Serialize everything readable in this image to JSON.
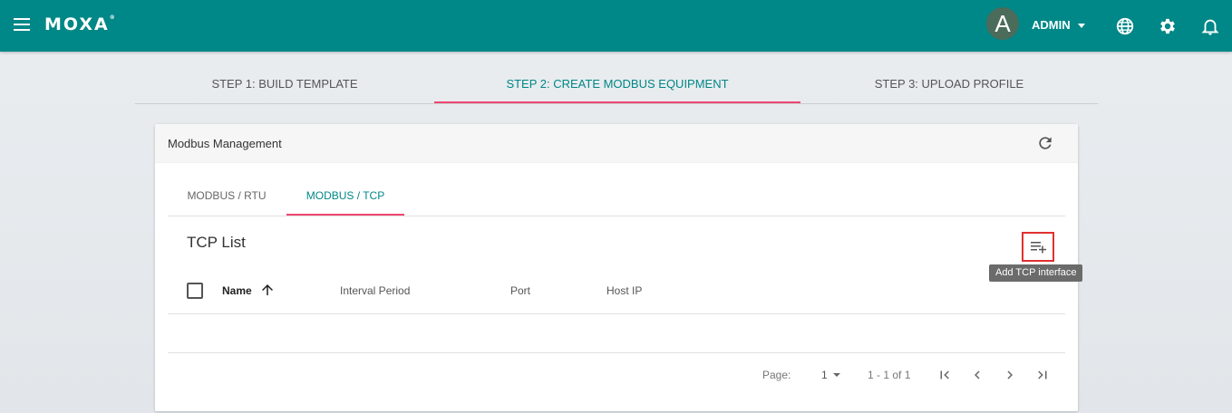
{
  "header": {
    "logo_text": "MOXA",
    "logo_mark": "®",
    "avatar_letter": "A",
    "user_name": "ADMIN",
    "menu_icon": "menu-icon",
    "globe_icon": "globe-icon",
    "settings_icon": "gear-icon",
    "notification_icon": "bell-icon",
    "brand_color": "#008787",
    "accent_color": "#ee4771"
  },
  "steps": [
    {
      "label": "STEP 1: BUILD TEMPLATE",
      "active": false
    },
    {
      "label": "STEP 2: CREATE MODBUS EQUIPMENT",
      "active": true
    },
    {
      "label": "STEP 3: UPLOAD PROFILE",
      "active": false
    }
  ],
  "card": {
    "title": "Modbus Management",
    "refresh_icon": "refresh-icon",
    "tabs": [
      {
        "label": "MODBUS / RTU",
        "active": false
      },
      {
        "label": "MODBUS / TCP",
        "active": true
      }
    ],
    "list_title": "TCP List",
    "add_button_icon": "playlist-add-icon",
    "add_tooltip": "Add TCP interface",
    "columns": [
      "Name",
      "Interval Period",
      "Port",
      "Host IP"
    ],
    "sort_icon": "arrow-up-icon",
    "rows": []
  },
  "paginator": {
    "page_label": "Page:",
    "page_value": "1",
    "range_label": "1 - 1 of 1",
    "first_icon": "first-page-icon",
    "prev_icon": "chevron-left-icon",
    "next_icon": "chevron-right-icon",
    "last_icon": "last-page-icon"
  }
}
